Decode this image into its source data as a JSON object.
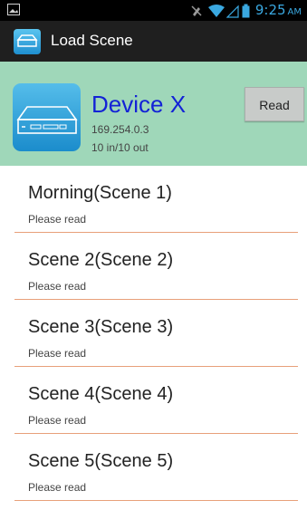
{
  "status_bar": {
    "time": "9:25",
    "ampm": "AM",
    "icons": [
      "image-icon",
      "mute-icon",
      "wifi-icon",
      "signal-icon",
      "battery-icon"
    ],
    "accent_color": "#3aa8e0"
  },
  "action_bar": {
    "title": "Load Scene",
    "icon": "device-icon"
  },
  "device": {
    "name": "Device X",
    "ip": "169.254.0.3",
    "io": "10 in/10 out",
    "read_label": "Read",
    "panel_color": "#9fd7b9",
    "name_color": "#1322d6"
  },
  "scenes": [
    {
      "title": "Morning(Scene 1)",
      "status": "Please read"
    },
    {
      "title": "Scene 2(Scene 2)",
      "status": "Please read"
    },
    {
      "title": "Scene 3(Scene 3)",
      "status": "Please read"
    },
    {
      "title": "Scene 4(Scene 4)",
      "status": "Please read"
    },
    {
      "title": "Scene 5(Scene 5)",
      "status": "Please read"
    }
  ],
  "divider_color": "#e8a07a"
}
